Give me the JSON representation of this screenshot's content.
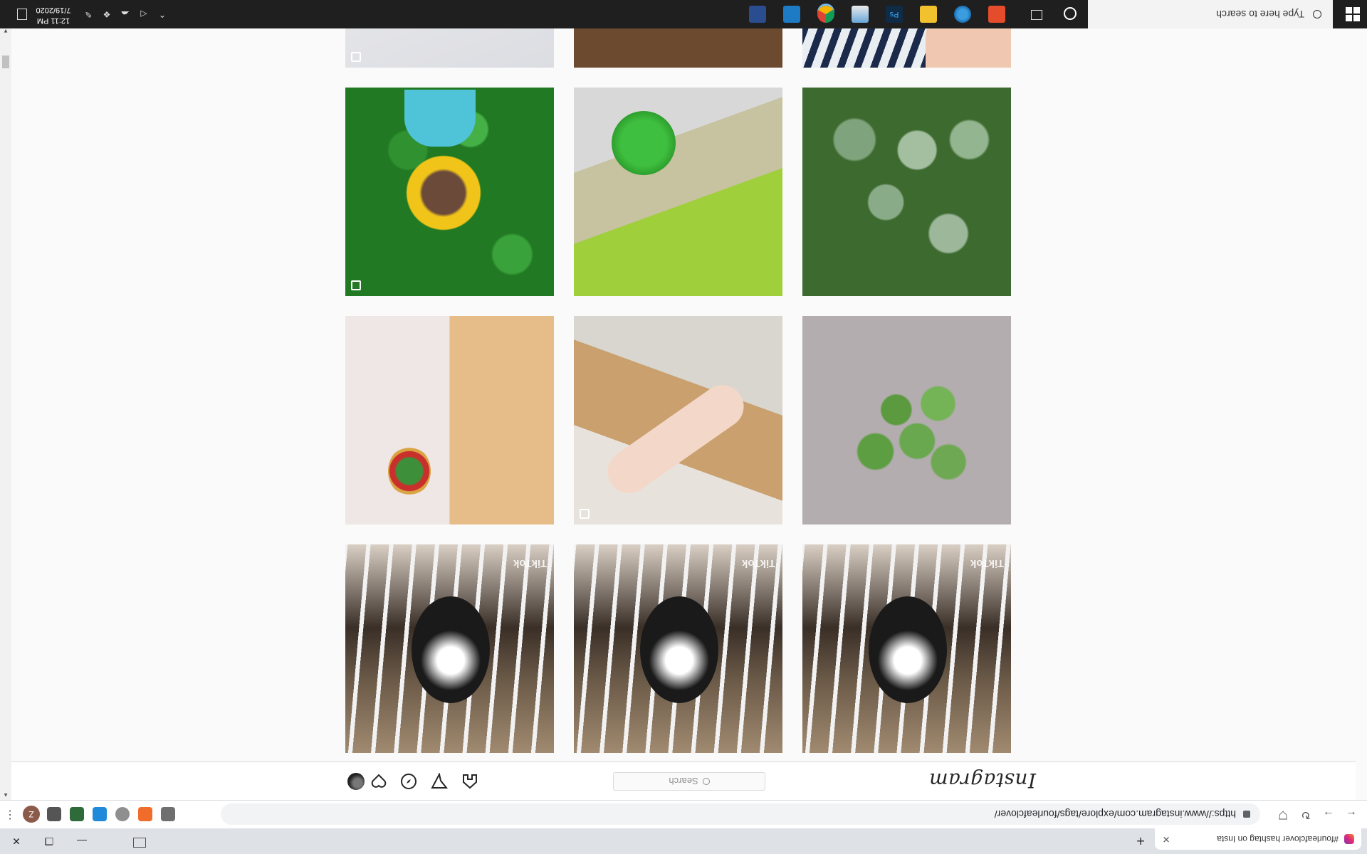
{
  "browser": {
    "tab_title": "#fourleafclover hashtag on Insta",
    "url": "https://www.instagram.com/explore/tags/fourleafclover/",
    "profile_initial": "Z"
  },
  "instagram": {
    "logo": "Instagram",
    "search_placeholder": "Search",
    "posts": [
      {
        "name": "post-cat-cage-1",
        "kind": "ph-cat",
        "tiktok": "TikTok",
        "badge": false
      },
      {
        "name": "post-cat-cage-2",
        "kind": "ph-cat",
        "tiktok": "TikTok",
        "badge": false
      },
      {
        "name": "post-cat-cage-3",
        "kind": "ph-cat",
        "tiktok": "TikTok",
        "badge": false
      },
      {
        "name": "post-clover-on-pavement",
        "kind": "ph-cloverpurple",
        "tiktok": "",
        "badge": false
      },
      {
        "name": "post-hands-desk",
        "kind": "ph-hands",
        "tiktok": "",
        "badge": true
      },
      {
        "name": "post-clover-pendant-package",
        "kind": "ph-pack",
        "tiktok": "",
        "badge": false
      },
      {
        "name": "post-clover-patch",
        "kind": "ph-clover1",
        "tiktok": "",
        "badge": false
      },
      {
        "name": "post-four-leaf-clover-grass",
        "kind": "ph-clover2",
        "tiktok": "",
        "badge": false
      },
      {
        "name": "post-doll-in-clovers",
        "kind": "ph-doll",
        "tiktok": "",
        "badge": true
      },
      {
        "name": "post-striped-shirt",
        "kind": "ph-stripes",
        "tiktok": "",
        "badge": false
      },
      {
        "name": "post-dog",
        "kind": "ph-dog",
        "tiktok": "",
        "badge": false
      },
      {
        "name": "post-jewelry",
        "kind": "ph-jewel",
        "tiktok": "",
        "badge": true
      }
    ]
  },
  "taskbar": {
    "search_placeholder": "Type here to search",
    "time": "12:11 PM",
    "date": "7/19/2020"
  }
}
